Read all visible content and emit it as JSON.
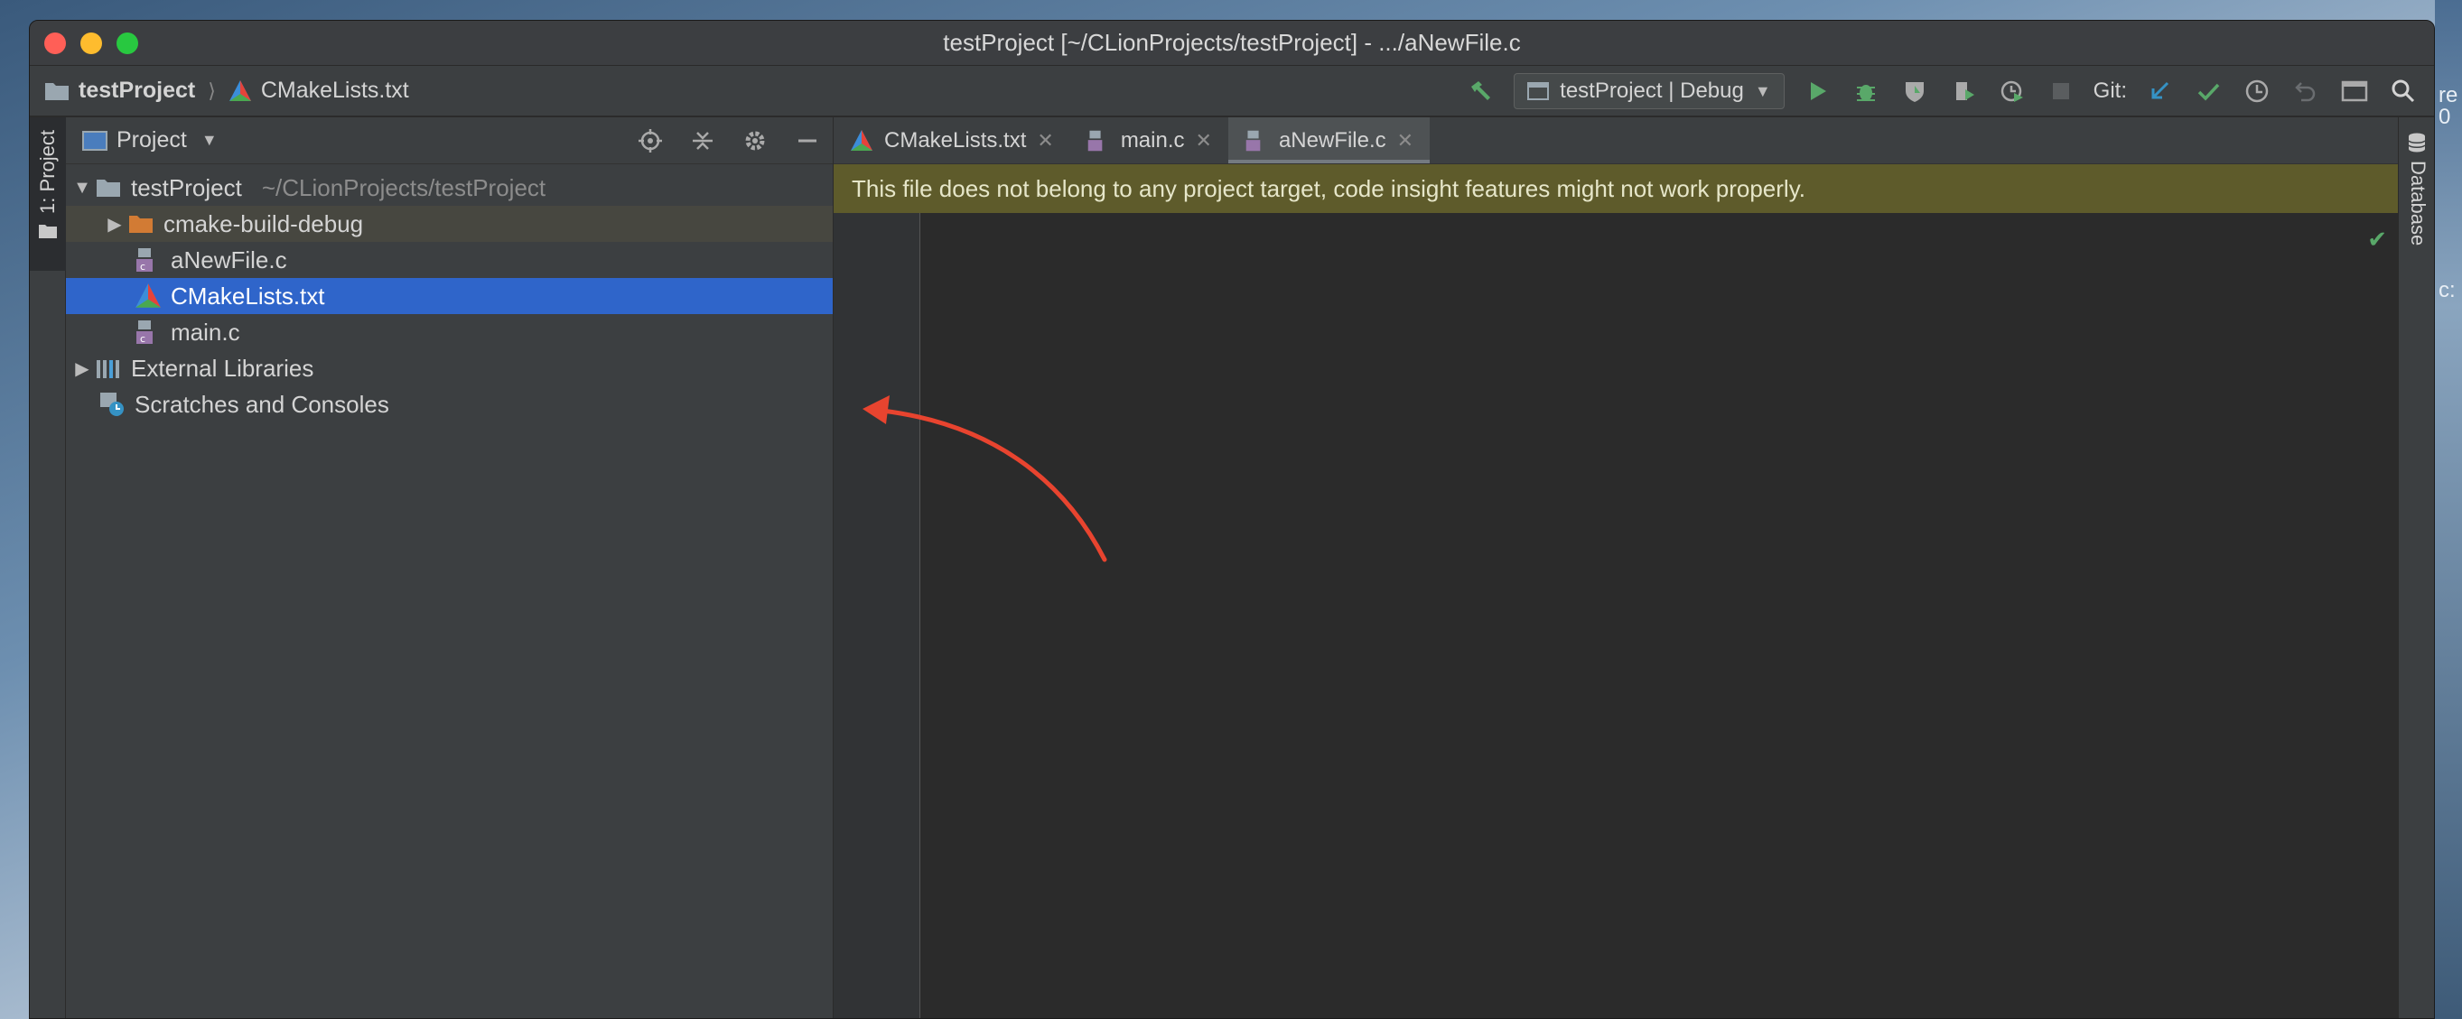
{
  "window": {
    "title": "testProject [~/CLionProjects/testProject] - .../aNewFile.c"
  },
  "desktop": {
    "edge_text_1": "re",
    "edge_text_2": "0",
    "edge_text_3": "c:"
  },
  "toolbar": {
    "breadcrumb_project": "testProject",
    "breadcrumb_file": "CMakeLists.txt",
    "run_config": "testProject | Debug",
    "git_label": "Git:"
  },
  "left_strip": {
    "project_tab": "1: Project"
  },
  "project_panel": {
    "title": "Project",
    "tree": {
      "root_name": "testProject",
      "root_path": "~/CLionProjects/testProject",
      "build_folder": "cmake-build-debug",
      "file_anewfile": "aNewFile.c",
      "file_cmakelists": "CMakeLists.txt",
      "file_main": "main.c",
      "external_libraries": "External Libraries",
      "scratches": "Scratches and Consoles"
    }
  },
  "editor": {
    "tabs": [
      {
        "label": "CMakeLists.txt"
      },
      {
        "label": "main.c"
      },
      {
        "label": "aNewFile.c"
      }
    ],
    "active_tab": "aNewFile.c",
    "warning_banner": "This file does not belong to any project target, code insight features might not work properly."
  },
  "right_strip": {
    "database_tab": "Database"
  },
  "colors": {
    "selection": "#2f65ca",
    "banner_bg": "#5e5b2b",
    "annotation_arrow": "#e8442f",
    "run_green": "#59a869",
    "git_blue": "#3592c4"
  },
  "icons": {
    "hammer": "build-hammer-icon",
    "run": "run-triangle-icon",
    "debug": "debug-bug-icon",
    "coverage": "coverage-icon",
    "profile": "profile-icon",
    "stop": "stop-icon",
    "git_update": "git-update-arrow-icon",
    "git_commit": "git-commit-check-icon",
    "git_history": "clock-history-icon",
    "git_rollback": "rollback-icon",
    "terminal": "terminal-window-icon",
    "search": "search-icon"
  }
}
